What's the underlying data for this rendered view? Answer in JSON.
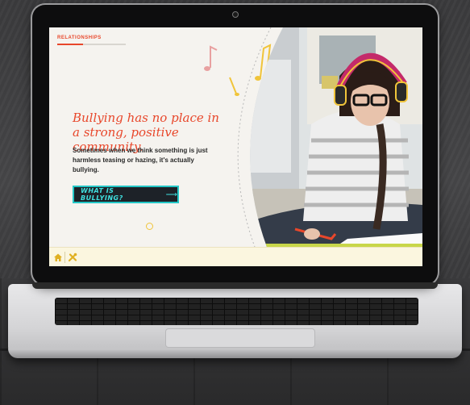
{
  "module": {
    "section_label": "RELATIONSHIPS",
    "progress_percent": 38
  },
  "hero": {
    "headline": "Bullying has no place in a strong, positive community.",
    "body": "Sometimes when we think something is just harmless teasing or hazing, it's actually bullying.",
    "cta_label": "WHAT IS BULLYING?",
    "cta_arrow": "⟶"
  },
  "footer": {
    "home_icon": "home-icon",
    "tools_icon": "tools-icon"
  },
  "colors": {
    "accent": "#e8472b",
    "cta_bg": "#1d2228",
    "cta_border": "#23c7c7",
    "footer_bg": "#fbf6df",
    "icon_yellow": "#e0b021"
  }
}
